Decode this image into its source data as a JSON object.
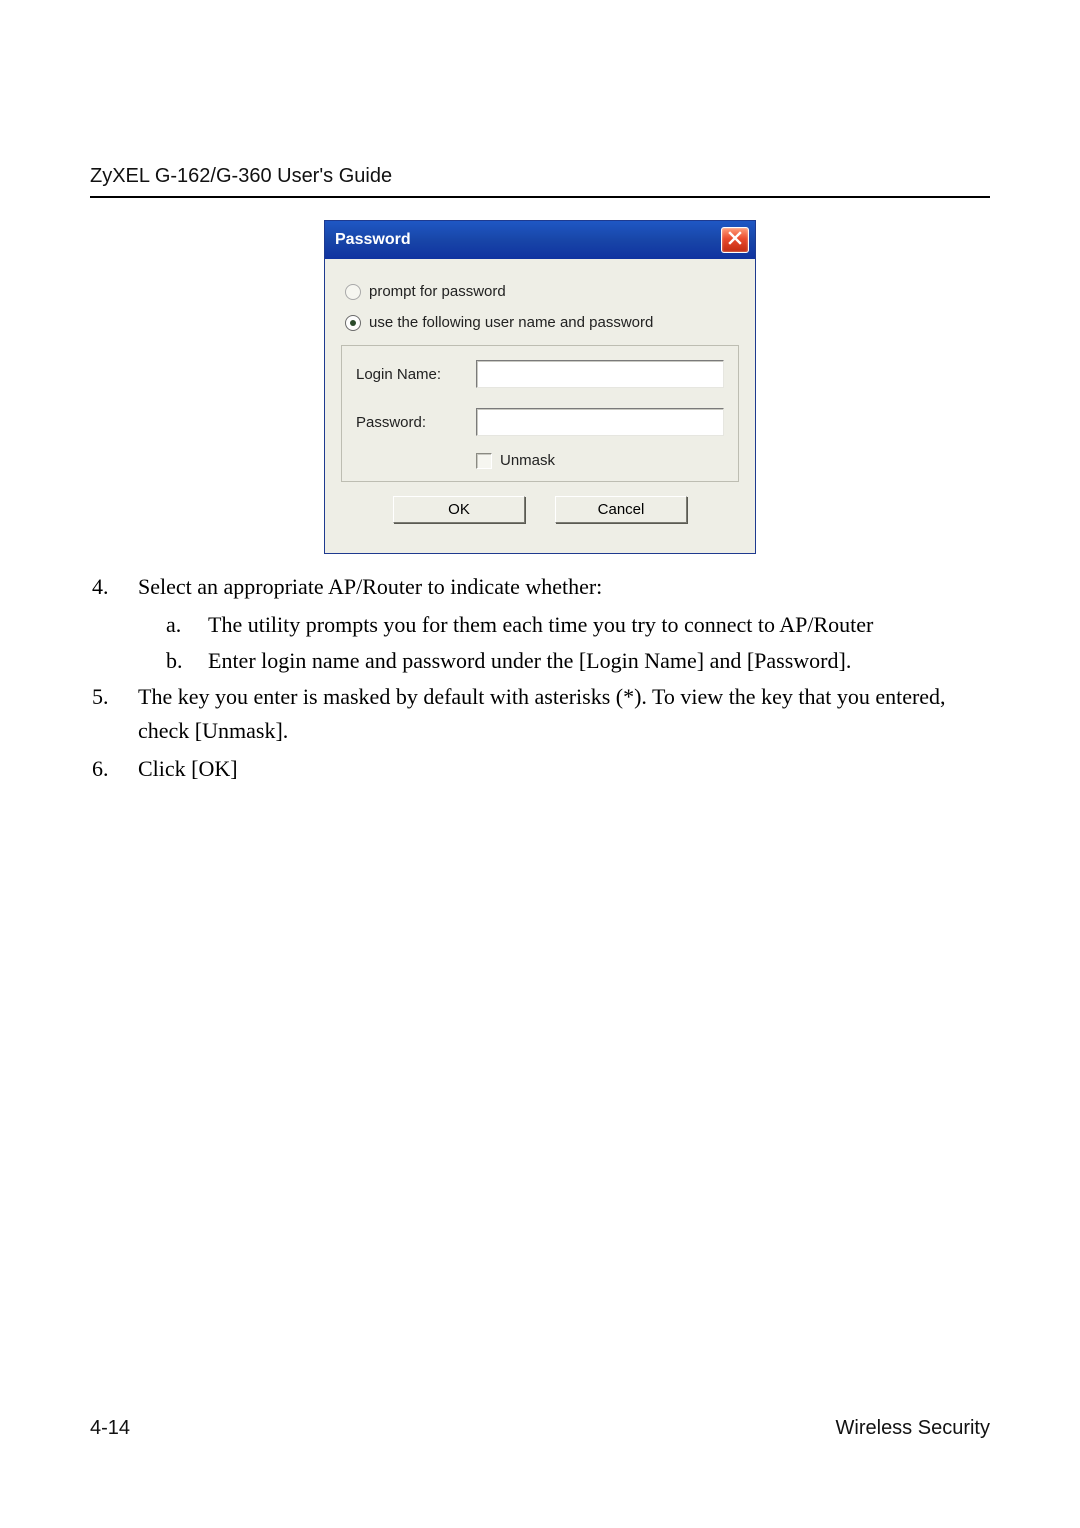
{
  "header": {
    "title": "ZyXEL G-162/G-360 User's Guide"
  },
  "dialog": {
    "title": "Password",
    "radio_prompt": "prompt for password",
    "radio_use": "use the following user name and password",
    "login_label": "Login Name:",
    "password_label": "Password:",
    "login_value": "",
    "password_value": "",
    "unmask_label": "Unmask",
    "ok_label": "OK",
    "cancel_label": "Cancel"
  },
  "instructions": {
    "items": [
      {
        "num": "4.",
        "text": "Select an appropriate AP/Router to indicate whether:",
        "sub": [
          {
            "num": "a.",
            "text": "The utility prompts you for them each time you try to connect to AP/Router"
          },
          {
            "num": "b.",
            "text": "Enter login name and password under the [Login Name] and [Password]."
          }
        ]
      },
      {
        "num": "5.",
        "text": "The key you enter is masked by default with asterisks (*).  To view the key that you entered, check [Unmask]."
      },
      {
        "num": "6.",
        "text": "Click [OK]"
      }
    ]
  },
  "footer": {
    "page": "4-14",
    "section": "Wireless Security"
  }
}
